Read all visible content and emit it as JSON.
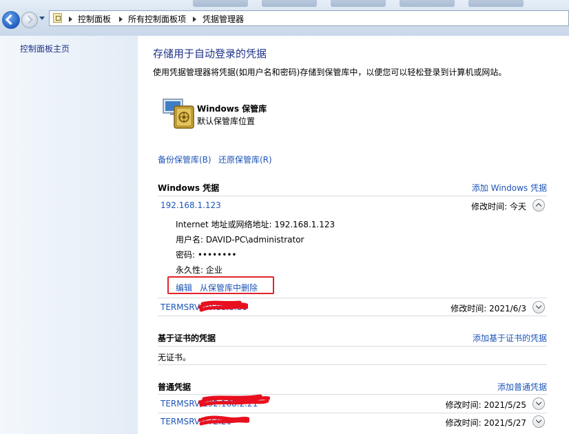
{
  "address_bar": {
    "crumbs": [
      "控制面板",
      "所有控制面板项",
      "凭据管理器"
    ]
  },
  "left_pane": {
    "home_link": "控制面板主页"
  },
  "main": {
    "title": "存储用于自动登录的凭据",
    "description": "使用凭据管理器将凭据(如用户名和密码)存储到保管库中，以便您可以轻松登录到计算机或网站。",
    "vault": {
      "name": "Windows 保管库",
      "subtitle": "默认保管库位置"
    },
    "backup_link": "备份保管库(B)",
    "restore_link": "还原保管库(R)"
  },
  "windows_credentials": {
    "heading": "Windows 凭据",
    "add_link": "添加 Windows 凭据",
    "items": [
      {
        "name": "192.168.1.123",
        "modified": "修改时间:  今天",
        "expanded": true,
        "details": {
          "address": "Internet 地址或网络地址:  192.168.1.123",
          "username": "用户名:  DAVID-PC\\administrator",
          "password": "密码:  ••••••••",
          "persistence": "永久性:  企业"
        },
        "edit_link": "编辑",
        "remove_link": "从保管库中删除"
      },
      {
        "name": "TERMSRV/10.88.8.80",
        "modified": "修改时间:  2021/6/3",
        "expanded": false
      }
    ]
  },
  "certificate_credentials": {
    "heading": "基于证书的凭据",
    "add_link": "添加基于证书的凭据",
    "empty_text": "无证书。"
  },
  "generic_credentials": {
    "heading": "普通凭据",
    "add_link": "添加普通凭据",
    "items": [
      {
        "name": "TERMSRV/192.168.2.21",
        "modified": "修改时间:  2021/5/25"
      },
      {
        "name": "TERMSRV/172.20",
        "modified": "修改时间:  2021/5/27"
      }
    ]
  },
  "colors": {
    "link": "#1c54b8",
    "title": "#1e3287",
    "highlight_box": "#e0242b",
    "redaction": "#e8101e"
  }
}
